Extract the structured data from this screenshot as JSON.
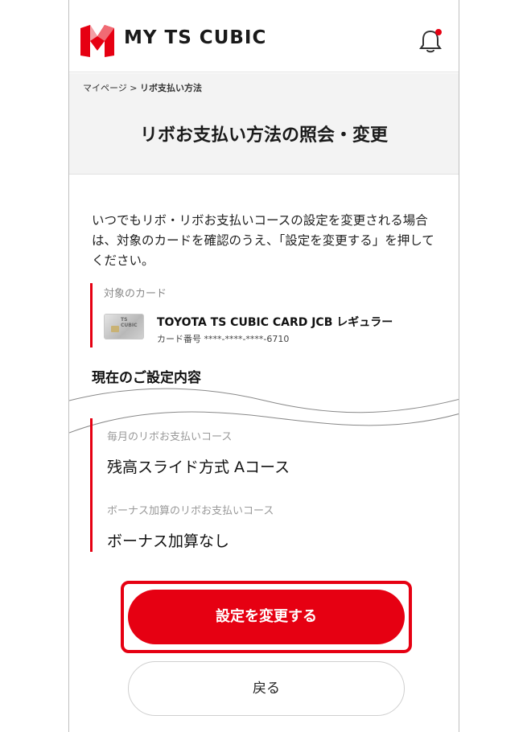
{
  "header": {
    "logo_text": "MY TS CUBIC",
    "bell_icon": "bell-icon",
    "notification_dot_color": "#e60012"
  },
  "breadcrumb": {
    "home": "マイページ",
    "separator": ">",
    "current": "リボ支払い方法"
  },
  "page_title": "リボお支払い方法の照会・変更",
  "intro": "いつでもリボ・リボお支払いコースの設定を変更される場合は、対象のカードを確認のうえ、「設定を変更する」を押してください。",
  "card": {
    "label": "対象のカード",
    "name": "TOYOTA TS CUBIC CARD JCB レギュラー",
    "number": "カード番号 ****-****-****-6710"
  },
  "current_settings": {
    "title": "現在のご設定内容",
    "monthly_label": "毎月のリボお支払いコース",
    "monthly_value": "残高スライド方式 Aコース",
    "bonus_label": "ボーナス加算のリボお支払いコース",
    "bonus_value": "ボーナス加算なし"
  },
  "buttons": {
    "change": "設定を変更する",
    "back": "戻る"
  },
  "colors": {
    "accent": "#e60012"
  }
}
